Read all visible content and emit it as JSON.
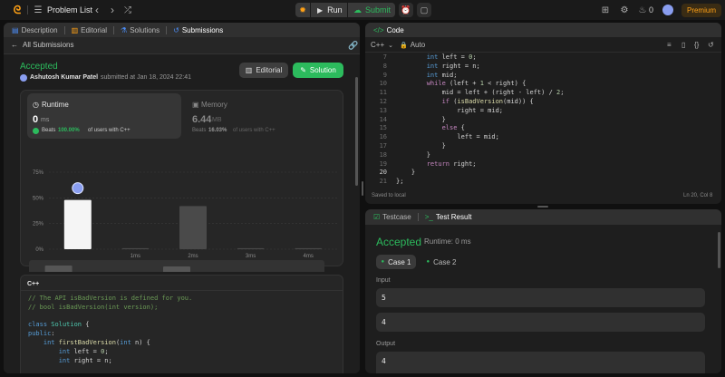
{
  "topbar": {
    "problem_list": "Problem List",
    "run": "Run",
    "submit": "Submit",
    "streak_count": "0",
    "premium": "Premium"
  },
  "left_tabs": {
    "description": "Description",
    "editorial": "Editorial",
    "solutions": "Solutions",
    "submissions": "Submissions"
  },
  "submission": {
    "back_label": "All Submissions",
    "status": "Accepted",
    "author": "Ashutosh Kumar Patel",
    "submitted_text": "submitted at Jan 18, 2024 22:41",
    "editorial_button": "Editorial",
    "solution_button": "Solution",
    "runtime": {
      "label": "Runtime",
      "value": "0",
      "unit": "ms",
      "beats_prefix": "Beats",
      "beats_pct": "100.00%",
      "beats_suffix": "of users with C++"
    },
    "memory": {
      "label": "Memory",
      "value": "6.44",
      "unit": "MB",
      "beats_prefix": "Beats",
      "beats_pct": "16.03%",
      "beats_suffix": "of users with C++"
    }
  },
  "chart_data": {
    "type": "bar",
    "categories": [
      "0ms",
      "1ms",
      "2ms",
      "3ms",
      "4ms"
    ],
    "tick_labels": [
      "",
      "1ms",
      "2ms",
      "3ms",
      "4ms"
    ],
    "values": [
      48,
      1,
      42,
      1,
      1
    ],
    "ylabels": [
      "75%",
      "50%",
      "25%",
      "0%"
    ],
    "ylim": [
      0,
      75
    ],
    "highlight_index": 0,
    "overview_values": [
      16,
      3,
      15,
      3,
      3
    ],
    "overview_labels": [
      "",
      "1ms",
      "2ms",
      "3ms",
      "4ms"
    ]
  },
  "submitted_code": {
    "language": "C++",
    "lines": [
      [
        [
          "cm",
          "// The API isBadVersion is defined for you."
        ]
      ],
      [
        [
          "cm",
          "// bool isBadVersion(int version);"
        ]
      ],
      [],
      [
        [
          "kw",
          "class "
        ],
        [
          "cls",
          "Solution"
        ],
        [
          "pl",
          " {"
        ]
      ],
      [
        [
          "kw",
          "public"
        ],
        [
          "pl",
          ":"
        ]
      ],
      [
        [
          "pl",
          "    "
        ],
        [
          "kw",
          "int "
        ],
        [
          "fn",
          "firstBadVersion"
        ],
        [
          "pl",
          "("
        ],
        [
          "kw",
          "int"
        ],
        [
          "pl",
          " n) {"
        ]
      ],
      [
        [
          "pl",
          "        "
        ],
        [
          "kw",
          "int"
        ],
        [
          "pl",
          " left = "
        ],
        [
          "nm",
          "0"
        ],
        [
          "pl",
          ";"
        ]
      ],
      [
        [
          "pl",
          "        "
        ],
        [
          "kw",
          "int"
        ],
        [
          "pl",
          " right = n;"
        ]
      ]
    ]
  },
  "editor": {
    "tab_label": "Code",
    "language": "C++",
    "auto_label": "Auto",
    "saved_status": "Saved to local",
    "cursor_position": "Ln 20, Col 8",
    "line_numbers": [
      "7",
      "8",
      "9",
      "10",
      "11",
      "12",
      "13",
      "14",
      "15",
      "16",
      "17",
      "18",
      "19",
      "20",
      "21"
    ],
    "lines": [
      [
        [
          "pl",
          "        "
        ],
        [
          "kw",
          "int"
        ],
        [
          "pl",
          " left = "
        ],
        [
          "nm",
          "0"
        ],
        [
          "pl",
          ";"
        ]
      ],
      [
        [
          "pl",
          "        "
        ],
        [
          "kw",
          "int"
        ],
        [
          "pl",
          " right = n;"
        ]
      ],
      [
        [
          "pl",
          "        "
        ],
        [
          "kw",
          "int"
        ],
        [
          "pl",
          " mid;"
        ]
      ],
      [
        [
          "pl",
          "        "
        ],
        [
          "pu",
          "while"
        ],
        [
          "pl",
          " (left + "
        ],
        [
          "nm",
          "1"
        ],
        [
          "pl",
          " < right) {"
        ]
      ],
      [
        [
          "pl",
          "            mid = left + (right - left) / "
        ],
        [
          "nm",
          "2"
        ],
        [
          "pl",
          ";"
        ]
      ],
      [
        [
          "pl",
          "            "
        ],
        [
          "pu",
          "if"
        ],
        [
          "pl",
          " ("
        ],
        [
          "fn",
          "isBadVersion"
        ],
        [
          "pl",
          "(mid)) {"
        ]
      ],
      [
        [
          "pl",
          "                right = mid;"
        ]
      ],
      [
        [
          "pl",
          "            }"
        ]
      ],
      [
        [
          "pl",
          "            "
        ],
        [
          "pu",
          "else"
        ],
        [
          "pl",
          " {"
        ]
      ],
      [
        [
          "pl",
          "                left = mid;"
        ]
      ],
      [
        [
          "pl",
          "            }"
        ]
      ],
      [
        [
          "pl",
          "        }"
        ]
      ],
      [
        [
          "pl",
          "        "
        ],
        [
          "pu",
          "return"
        ],
        [
          "pl",
          " right;"
        ]
      ],
      [
        [
          "pl",
          "    }"
        ]
      ],
      [
        [
          "pl",
          "};"
        ]
      ]
    ]
  },
  "results": {
    "testcase_tab": "Testcase",
    "result_tab": "Test Result",
    "status": "Accepted",
    "runtime": "Runtime: 0 ms",
    "case1": "Case 1",
    "case2": "Case 2",
    "input_label": "Input",
    "input_values": [
      "5",
      "4"
    ],
    "output_label": "Output",
    "output_value": "4"
  },
  "colors": {
    "accent_green": "#2cbb5d",
    "premium": "#ffa116",
    "blue_tab": "#4c8df6"
  }
}
